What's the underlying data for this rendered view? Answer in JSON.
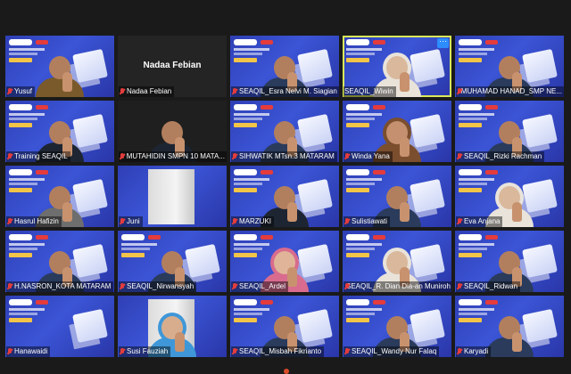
{
  "window": {
    "title": ""
  },
  "participants": [
    {
      "name": "Yusuf",
      "muted": true,
      "type": "bg",
      "person": "batik"
    },
    {
      "name": "Nadaa Febian",
      "muted": true,
      "type": "blank",
      "center_label": "Nadaa Febian"
    },
    {
      "name": "SEAQIL_Esra Nelvi M. Siagian",
      "muted": true,
      "type": "bg",
      "person": "plain"
    },
    {
      "name": "SEAQIL_Wiwin",
      "muted": false,
      "type": "bg",
      "person": "hijab",
      "active": true
    },
    {
      "name": "MUHAMAD HANAD_SMP NE...",
      "muted": true,
      "type": "bg",
      "person": "plain"
    },
    {
      "name": "Training SEAQIL",
      "muted": true,
      "type": "bg",
      "person": "dark"
    },
    {
      "name": "MUTAHIDIN SMPN 10 MATA...",
      "muted": true,
      "type": "dark",
      "person": "dark"
    },
    {
      "name": "SIHWATIK MTsn.3 MATARAM",
      "muted": true,
      "type": "bg",
      "person": "plain"
    },
    {
      "name": "Winda Yana",
      "muted": true,
      "type": "bg",
      "person": "hijab-brown"
    },
    {
      "name": "SEAQIL_Rizki Rachman",
      "muted": true,
      "type": "bg",
      "person": "plain"
    },
    {
      "name": "Hasrul Hafizin",
      "muted": true,
      "type": "bg",
      "person": "grey"
    },
    {
      "name": "Juni",
      "muted": true,
      "type": "room",
      "person": "none"
    },
    {
      "name": "MARZUKI",
      "muted": true,
      "type": "bg",
      "person": "dark"
    },
    {
      "name": "Sulistiawati",
      "muted": true,
      "type": "bg",
      "person": "hijab-green"
    },
    {
      "name": "Eva Anjana",
      "muted": true,
      "type": "bg",
      "person": "hijab"
    },
    {
      "name": "H.NASRON_KOTA MATARAM",
      "muted": true,
      "type": "bg",
      "person": "plain"
    },
    {
      "name": "SEAQIL_Nirwansyah",
      "muted": true,
      "type": "bg",
      "person": "plain"
    },
    {
      "name": "SEAQIL_Ardel",
      "muted": true,
      "type": "bg",
      "person": "hijab-pink"
    },
    {
      "name": "SEAQIL_R. Dian Dia-an Muniroh",
      "muted": true,
      "type": "bg",
      "person": "hijab"
    },
    {
      "name": "SEAQIL_Ridwan",
      "muted": true,
      "type": "bg",
      "person": "plain"
    },
    {
      "name": "Hanawaidi",
      "muted": true,
      "type": "bg",
      "person": "none"
    },
    {
      "name": "Susi Fauziah",
      "muted": true,
      "type": "room",
      "person": "hijab-blue"
    },
    {
      "name": "SEAQIL_Misbah Fikrianto",
      "muted": true,
      "type": "bg",
      "person": "plain"
    },
    {
      "name": "SEAQIL_Wandy Nur Falaq",
      "muted": true,
      "type": "bg",
      "person": "plain"
    },
    {
      "name": "Karyadi",
      "muted": true,
      "type": "bg",
      "person": "plain"
    }
  ],
  "more_button": "···",
  "colors": {
    "active_border": "#d9e95a",
    "muted_icon": "#e23c3c",
    "tile_bg": "#3b55d6"
  }
}
